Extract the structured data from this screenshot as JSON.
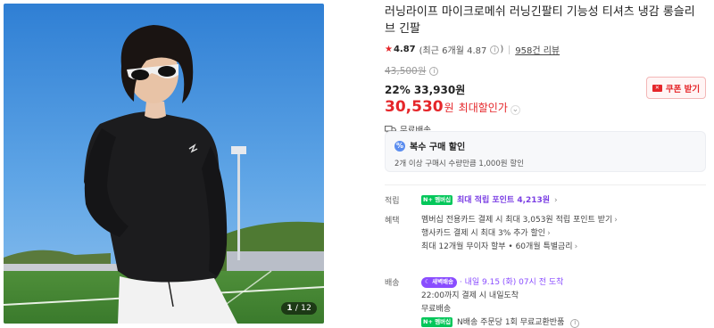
{
  "photo": {
    "counter_current": "1",
    "counter_total": "/ 12"
  },
  "product": {
    "title": "러닝라이프 마이크로메쉬 러닝긴팔티 기능성 티셔츠 냉감 롱슬리브 긴팔",
    "rating": "4.87",
    "rating_detail": "(최근 6개월 4.87",
    "review_link": "958건 리뷰",
    "original_price": "43,500원",
    "discount_rate": "22%",
    "sale_price": "33,930원",
    "final_price": "30,530",
    "final_unit": "원",
    "max_discount_label": "최대할인가",
    "coupon_button": "쿠폰 받기",
    "shipping": "무료배송"
  },
  "bundle": {
    "title": "복수 구매 할인",
    "description": "2개 이상 구매시 수량만큼 1,000원 할인"
  },
  "points": {
    "label": "적립",
    "npay_badge": "N+ 멤버십",
    "text": "최대 적립 포인트 4,213원"
  },
  "benefits": {
    "label": "혜택",
    "lines": [
      "멤버십 전용카드 결제 시 최대 3,053원 적립 포인트 받기",
      "행사카드 결제 시 최대 3% 추가 할인",
      "최대 12개월 무이자 할부 • 60개월 특별금리"
    ]
  },
  "delivery": {
    "label": "배송",
    "express_badge": "새벽배송",
    "express_date": "· 내일 9.15 (화) 07시 전 도착",
    "line2": "22:00까지 결제 시 내일도착",
    "line3": "무료배송",
    "npay_badge": "N+ 멤버십",
    "line4": "N배송 주문당 1회 무료교환반품"
  },
  "colors": {
    "accent_red": "#e5262a",
    "naver_green": "#03c75a",
    "purple": "#7b3fe4"
  }
}
